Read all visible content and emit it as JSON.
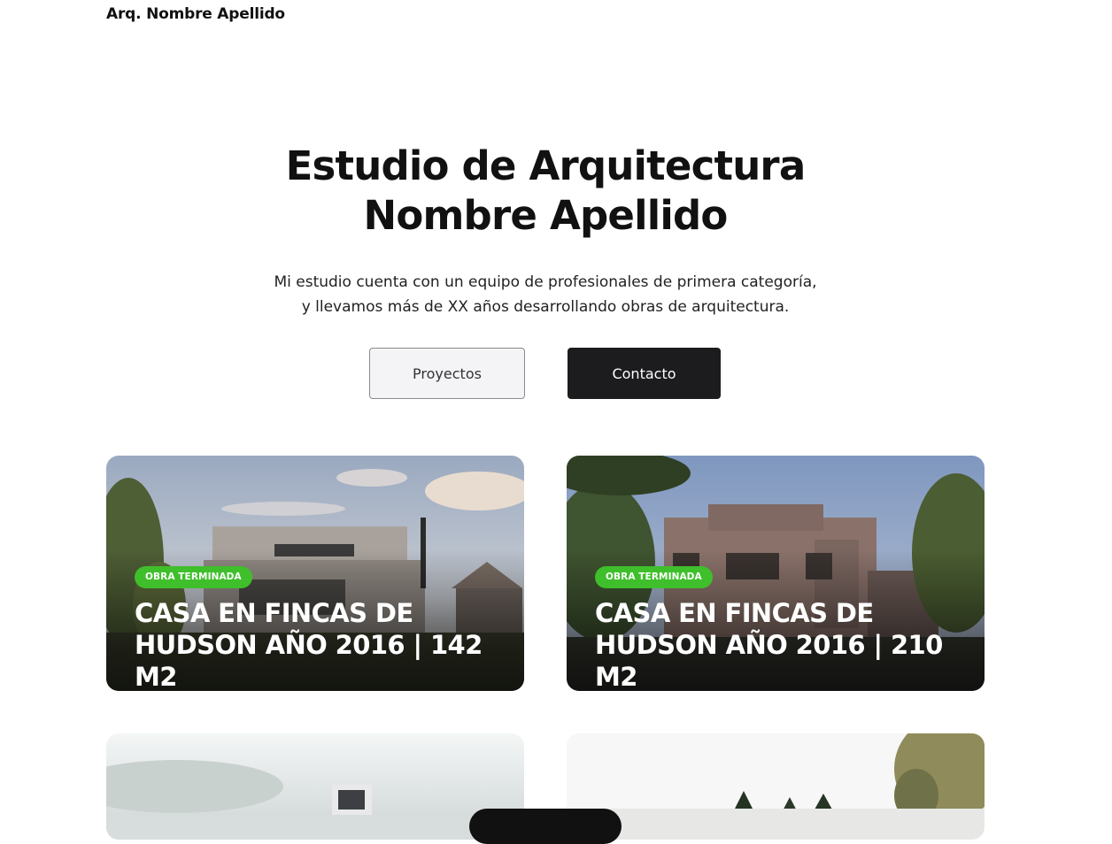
{
  "header": {
    "brand": "Arq. Nombre Apellido"
  },
  "hero": {
    "title_line1": "Estudio de Arquitectura",
    "title_line2": "Nombre Apellido",
    "description_line1": "Mi estudio cuenta con un equipo de profesionales de primera categoría,",
    "description_line2": "y llevamos más de XX años desarrollando obras de arquitectura.",
    "buttons": {
      "secondary_label": "Proyectos",
      "primary_label": "Contacto"
    }
  },
  "projects": [
    {
      "badge": "OBRA TERMINADA",
      "title_line1": "CASA EN FINCAS DE",
      "title_line2": "HUDSON AÑO 2016 | 142 M2"
    },
    {
      "badge": "OBRA TERMINADA",
      "title_line1": "CASA EN FINCAS DE",
      "title_line2": "HUDSON AÑO 2016 | 210 M2"
    }
  ],
  "colors": {
    "badge": "#3fbf2b",
    "primary_button": "#1c1c1e",
    "secondary_button": "#f4f4f6"
  }
}
